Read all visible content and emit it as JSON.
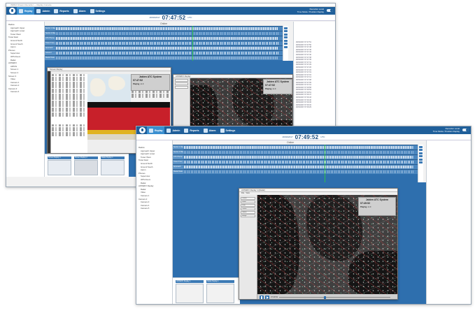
{
  "back_window": {
    "titlebar": "INDRA Stream Recorder — Replay Console",
    "ribbon": {
      "tabs": [
        {
          "label": "Replay",
          "active": true
        },
        {
          "label": "Admin",
          "active": false
        },
        {
          "label": "Reports",
          "active": false
        },
        {
          "label": "Alarm",
          "active": false
        },
        {
          "label": "Settings",
          "active": false
        }
      ],
      "right_line1": "Recorder Local",
      "right_line2": "Time Mode / Position Replay"
    },
    "clock": {
      "date": "26/04/2017",
      "time": "07:47:52",
      "tz": "UTC"
    },
    "online_label": "Online",
    "timeline_channels": [
      "Sector 1 Radio",
      "Sector 2 Radio",
      "ATC Phone",
      "Tower Freq",
      "Approach",
      "Ground",
      "Radar Data"
    ],
    "sidebar_items": [
      "Radios",
      "Approach Upper",
      "Approach Lower",
      "Tower West",
      "Tower East",
      "Ground North",
      "Ground South",
      "Apron",
      "Phones",
      "Supervisor",
      "OPS Room",
      "Radar",
      "ASTERIX",
      "ARTAS",
      "Screen 1",
      "Screen 2",
      "Screen 3",
      "Video",
      "Camera 1",
      "Camera 2",
      "Camera 3",
      "Camera 4"
    ],
    "log_lines": [
      "26/04/2017 07:47:51",
      "26/04/2017 07:47:50",
      "26/04/2017 07:47:48",
      "26/04/2017 07:47:45",
      "26/04/2017 07:47:42",
      "26/04/2017 07:47:40",
      "26/04/2017 07:47:38",
      "26/04/2017 07:47:35",
      "26/04/2017 07:47:31",
      "26/04/2017 07:47:29",
      "26/04/2017 07:47:26",
      "26/04/2017 07:47:22",
      "26/04/2017 07:47:19",
      "26/04/2017 07:47:15",
      "26/04/2017 07:47:12",
      "26/04/2017 07:47:08",
      "26/04/2017 07:47:05",
      "26/04/2017 07:47:01",
      "26/04/2017 07:46:58",
      "26/04/2017 07:46:54",
      "26/04/2017 07:46:51",
      "26/04/2017 07:46:47",
      "26/04/2017 07:46:43",
      "26/04/2017 07:46:40",
      "26/04/2017 07:46:36",
      "26/04/2017 07:46:32",
      "26/04/2017 07:46:29"
    ],
    "popup_left": {
      "title": "Screen Replay",
      "overlay_title": "Jakten ATC System",
      "overlay_clock": "07:47:52",
      "overlay_status": "Playing",
      "overlay_speed": "x1.0"
    },
    "popup_right": {
      "title": "ASTERIX Replay",
      "overlay_title": "Jakten ATC System",
      "overlay_clock": "07:47:52",
      "overlay_status": "Playing",
      "overlay_speed": "x1.0"
    },
    "bottom_tabs": [
      "Screen Replay 1",
      "Screen Replay 2",
      "Radar Replay 1"
    ]
  },
  "front_window": {
    "ribbon": {
      "tabs": [
        {
          "label": "Replay",
          "active": true
        },
        {
          "label": "Admin",
          "active": false
        },
        {
          "label": "Reports",
          "active": false
        },
        {
          "label": "Alarm",
          "active": false
        },
        {
          "label": "Settings",
          "active": false
        }
      ],
      "right_line1": "Recorder Local",
      "right_line2": "Time Mode / Position Replay"
    },
    "clock": {
      "date": "26/04/2017",
      "time": "07:49:52",
      "tz": "UTC"
    },
    "online_label": "Online",
    "timeline_channels": [
      "Sector 1 Radio",
      "Sector 2 Radio",
      "ATC Phone",
      "Tower Freq",
      "Approach",
      "Radar Data"
    ],
    "sidebar_items": [
      "Radios",
      "Approach Upper",
      "Approach Lower",
      "Tower West",
      "Tower East",
      "Ground North",
      "Ground South",
      "Apron",
      "Phones",
      "Supervisor",
      "OPS Room",
      "Radar",
      "ASTERIX Replay",
      "Radar",
      "Video",
      "Camera 1",
      "Camera 2",
      "Camera 3",
      "Camera 4",
      "Camera 5"
    ],
    "popup": {
      "title": "ASTERIX Replay 1 (Radar)",
      "menu": [
        "File",
        "View"
      ],
      "overlay_title": "Jakten ATC System",
      "overlay_clock": "07:49:52",
      "overlay_status": "Playing",
      "overlay_speed": "x1.0",
      "side_buttons": [
        "Center",
        "Zoom",
        "Filter",
        "Tracks",
        "Labels",
        "Range"
      ],
      "play_time": "07:49:52"
    },
    "bottom_tabs": [
      "ASTERIX Replay 1",
      "Radar Replay 1"
    ]
  }
}
